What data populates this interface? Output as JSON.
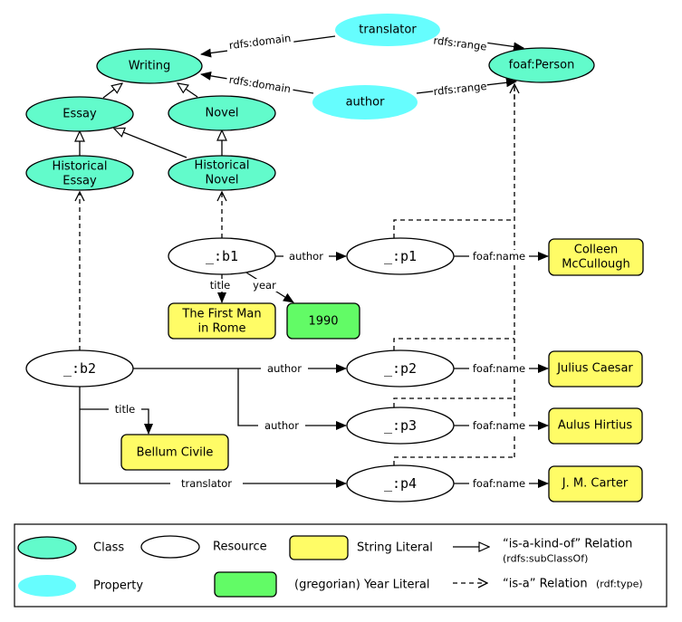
{
  "colors": {
    "class": "#62fbcb",
    "property": "#66fdfe",
    "string_literal": "#fffc66",
    "year_literal": "#62fb66",
    "resource": "#ffffff"
  },
  "classes": {
    "writing": "Writing",
    "essay": "Essay",
    "novel": "Novel",
    "historical_essay": [
      "Historical",
      "Essay"
    ],
    "historical_novel": [
      "Historical",
      "Novel"
    ],
    "person": "foaf:Person"
  },
  "properties": {
    "translator": "translator",
    "author": "author"
  },
  "resources": {
    "b1": "_:b1",
    "b2": "_:b2",
    "p1": "_:p1",
    "p2": "_:p2",
    "p3": "_:p3",
    "p4": "_:p4"
  },
  "literals": {
    "colleen": [
      "Colleen",
      "McCullough"
    ],
    "first_man": [
      "The First Man",
      "in Rome"
    ],
    "year": "1990",
    "julius": "Julius Caesar",
    "aulus": "Aulus Hirtius",
    "carter": "J. M. Carter",
    "bellum": "Bellum Civile"
  },
  "edge_labels": {
    "domain": "rdfs:domain",
    "range": "rdfs:range",
    "author": "author",
    "title": "title",
    "year": "year",
    "foaf_name": "foaf:name",
    "translator": "translator"
  },
  "legend": {
    "class": "Class",
    "resource": "Resource",
    "string_literal": "String Literal",
    "property": "Property",
    "year_literal": "(gregorian) Year Literal",
    "subclass": "“is-a-kind-of” Relation",
    "subclass_note": "(rdfs:subClassOf)",
    "type": "“is-a” Relation",
    "type_note": "(rdf:type)"
  }
}
